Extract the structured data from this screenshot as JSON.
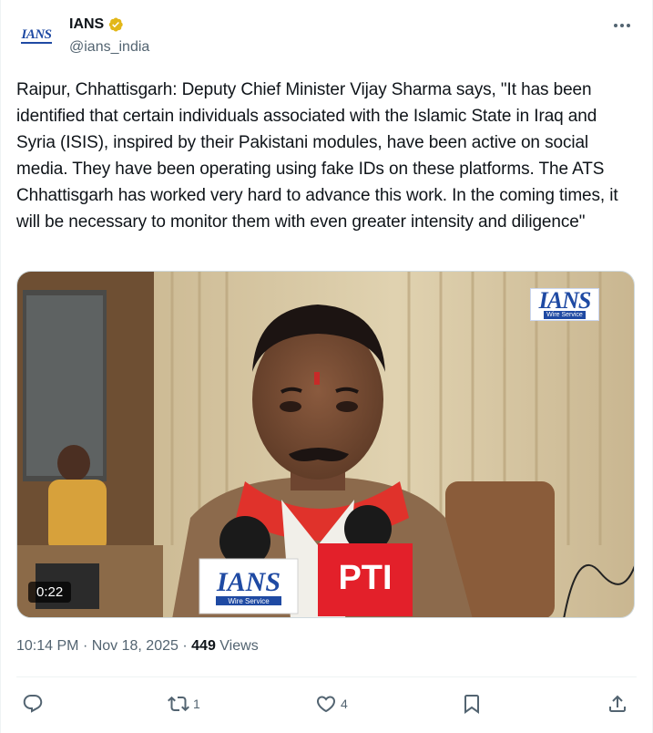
{
  "author": {
    "display_name": "IANS",
    "handle": "@ians_india",
    "avatar_logo": "IANS",
    "verified_icon": "verified-badge-icon",
    "verified_color": "#e2b719"
  },
  "tweet": {
    "text": "Raipur, Chhattisgarh: Deputy Chief Minister Vijay Sharma says, \"It has been identified that certain individuals associated with the Islamic State in Iraq and Syria (ISIS), inspired by their Pakistani modules, have been active on social media. They have been operating using fake IDs on these platforms. The ATS Chhattisgarh has worked very hard to advance this work. In the coming times, it will be necessary to monitor them with even greater intensity and diligence\""
  },
  "media": {
    "duration": "0:22",
    "watermark": "IANS",
    "watermark_sub": "Wire Service",
    "mic_left_label": "IANS",
    "mic_left_sub": "Wire Service",
    "mic_right_label": "PTI"
  },
  "meta": {
    "time": "10:14 PM",
    "separator": "·",
    "date": "Nov 18, 2025",
    "views_count": "449",
    "views_label": "Views"
  },
  "actions": {
    "reply_icon": "reply-icon",
    "retweet_icon": "retweet-icon",
    "retweet_count": "1",
    "like_icon": "heart-icon",
    "like_count": "4",
    "bookmark_icon": "bookmark-icon",
    "share_icon": "share-icon"
  },
  "colors": {
    "text": "#0f1419",
    "secondary": "#536471",
    "brand_blue": "#1f4aa3",
    "pti_red": "#e3202a"
  }
}
